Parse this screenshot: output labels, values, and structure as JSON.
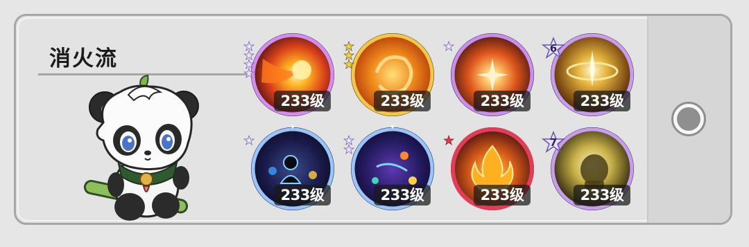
{
  "title": "消火流",
  "colors": {
    "card_bg": "#e3e3e3",
    "border": "#a6a6a6",
    "side_panel": "#d6d6d6",
    "radio": "#8f8f8f"
  },
  "skills": [
    {
      "name": "fire-meteor-skill",
      "level": "233级",
      "stars": 4,
      "star_style": "silver",
      "ring": "#d48cf0"
    },
    {
      "name": "fire-vortex-skill",
      "level": "233级",
      "stars": 3,
      "star_style": "gold",
      "ring": "#f3c845"
    },
    {
      "name": "fire-burst-skill",
      "level": "233级",
      "stars": 1,
      "star_style": "silver",
      "ring": "#c98ef0"
    },
    {
      "name": "golden-radiance-skill",
      "level": "233级",
      "star_count": "6",
      "ring": "#c99cf2"
    },
    {
      "name": "spirit-meditation-skill",
      "level": "233级",
      "stars": 1,
      "star_style": "silver",
      "ring": "#98c4ff"
    },
    {
      "name": "mystic-aura-skill",
      "level": "233级",
      "stars": 2,
      "star_style": "silver",
      "ring": "#98c4ff"
    },
    {
      "name": "flame-bonfire-skill",
      "level": "233级",
      "stars": 1,
      "star_style": "red",
      "ring": "#e23c56"
    },
    {
      "name": "golden-fist-skill",
      "level": "233级",
      "star_count": "7",
      "ring": "#c99cf2"
    }
  ]
}
